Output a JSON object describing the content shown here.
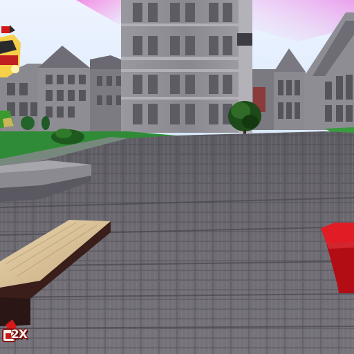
{
  "game": {
    "hud": {
      "badge_label": "2X",
      "badge_icon": "character-badge-icon"
    }
  },
  "colors": {
    "sky_top": "#f4d6ee",
    "sky_bottom": "#cfe6ff",
    "pink_haze": "#f08ce6",
    "grass": "#2e8a36",
    "pavement": "#6d6a72",
    "building_stone": "#8d8b92",
    "bench_wood": "#d9c29a",
    "red_block": "#cc0d16",
    "tree_green": "#1f4f1a"
  }
}
